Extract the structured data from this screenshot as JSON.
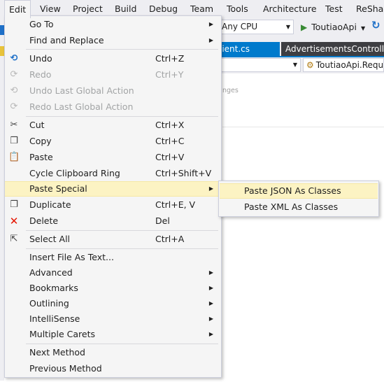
{
  "menubar": {
    "items": [
      "Edit",
      "View",
      "Project",
      "Build",
      "Debug",
      "Team",
      "Tools",
      "Architecture",
      "Test",
      "ReSharper"
    ]
  },
  "toolbar": {
    "platform": "Any CPU",
    "run_target": "ToutiaoApi"
  },
  "tabs": {
    "tab1": "lient.cs",
    "tab2": "AdvertisementsControlle"
  },
  "navbar": {
    "member": "ToutiaoApi.Requ"
  },
  "editor": {
    "hint": "nges"
  },
  "edit_menu": {
    "goto": "Go To",
    "find_replace": "Find and Replace",
    "undo": "Undo",
    "undo_sc": "Ctrl+Z",
    "redo": "Redo",
    "redo_sc": "Ctrl+Y",
    "undo_global": "Undo Last Global Action",
    "redo_global": "Redo Last Global Action",
    "cut": "Cut",
    "cut_sc": "Ctrl+X",
    "copy": "Copy",
    "copy_sc": "Ctrl+C",
    "paste": "Paste",
    "paste_sc": "Ctrl+V",
    "cycle": "Cycle Clipboard Ring",
    "cycle_sc": "Ctrl+Shift+V",
    "paste_special": "Paste Special",
    "duplicate": "Duplicate",
    "duplicate_sc": "Ctrl+E, V",
    "delete": "Delete",
    "delete_sc": "Del",
    "select_all": "Select All",
    "select_all_sc": "Ctrl+A",
    "insert_file": "Insert File As Text...",
    "advanced": "Advanced",
    "bookmarks": "Bookmarks",
    "outlining": "Outlining",
    "intellisense": "IntelliSense",
    "multiple_carets": "Multiple Carets",
    "next_method": "Next Method",
    "previous_method": "Previous Method"
  },
  "paste_special_menu": {
    "json": "Paste JSON As Classes",
    "xml": "Paste XML As Classes"
  },
  "colors": {
    "menu_bg": "#f5f5f5",
    "highlight": "#fcf3c3",
    "accent": "#007acc",
    "delete_icon": "#e51400"
  }
}
